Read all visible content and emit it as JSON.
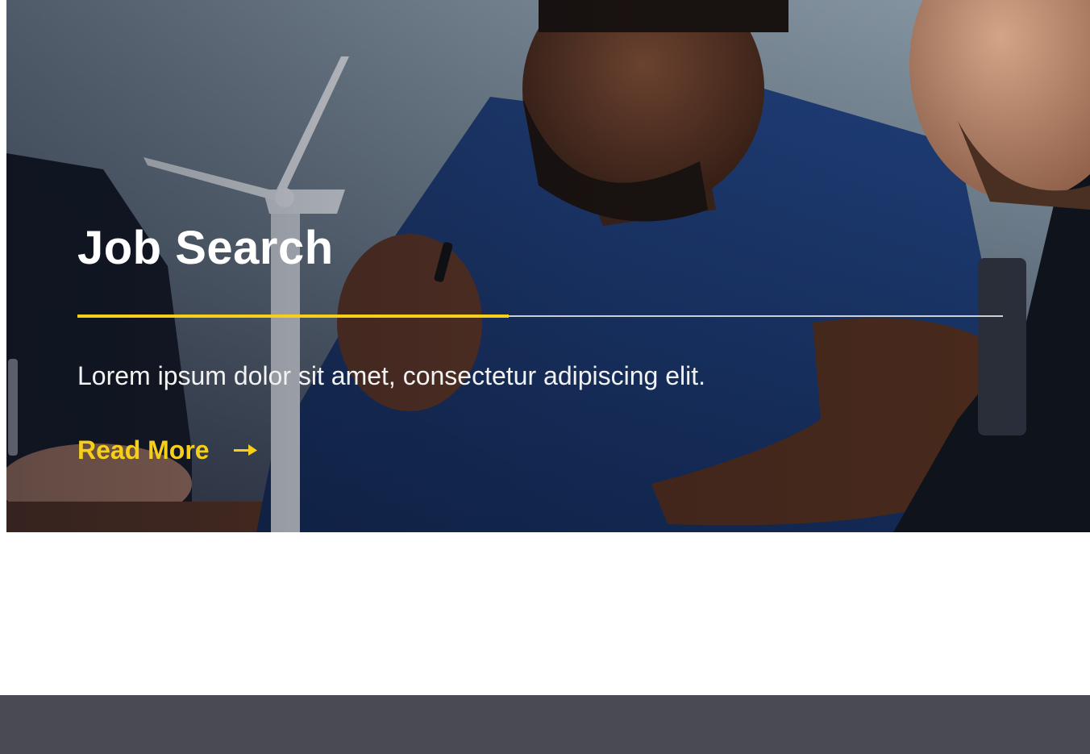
{
  "hero": {
    "title": "Job Search",
    "description": "Lorem ipsum dolor sit amet, consectetur adipiscing elit.",
    "read_more_label": "Read More",
    "read_more_icon": "arrow-right-icon",
    "progress_fraction": 0.466,
    "background_image": "photo of people in meeting with wind turbine model"
  },
  "colors": {
    "accent": "#f5cf19",
    "title": "#ffffff",
    "footer": "#4a4a55"
  }
}
